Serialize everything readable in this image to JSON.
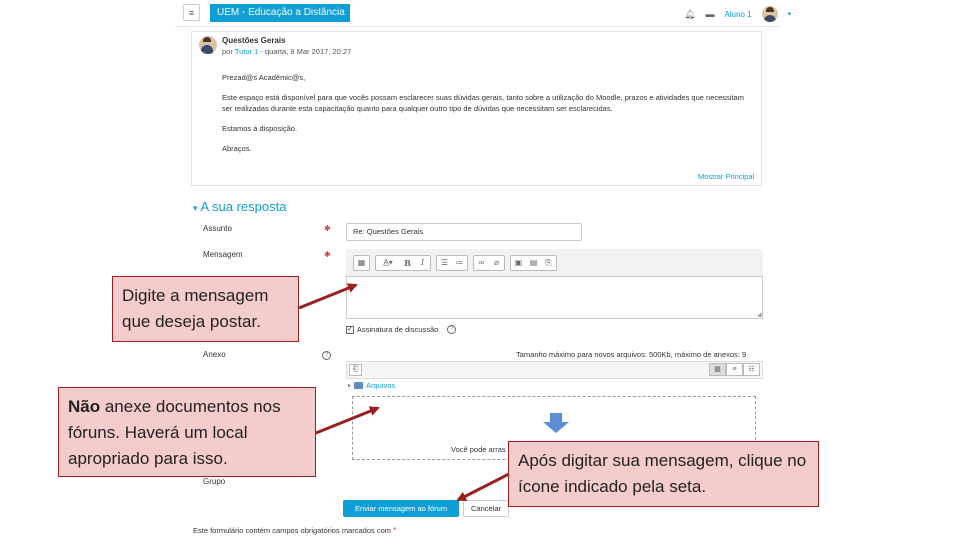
{
  "navbar": {
    "menu_icon": "hamburger-icon",
    "brand": "UEM - Educação a Distância",
    "user_name": "Aluno 1"
  },
  "post": {
    "title": "Questões Gerais",
    "meta_prefix": "por ",
    "author": "Tutor 1",
    "meta_suffix": " - quarta, 8 Mar 2017, 20:27",
    "paragraphs": [
      "Prezad@s Acadêmic@s,",
      "Este espaço está disponível para que vocês possam esclarecer suas dúvidas gerais, tanto sobre a utilização do Moodle, prazos e atividades que necessitam ser realizadas durante esta capacitação quanto para qualquer outro tipo de dúvidas que necessitam ser esclarecidas.",
      "Estamos à disposição.",
      "Abraços."
    ],
    "show_parent": "Mostrar Principal"
  },
  "reply": {
    "section_title": "A sua resposta",
    "subject_label": "Assunto",
    "subject_value": "Re: Questões Gerais",
    "message_label": "Mensagem",
    "signature_label": "Assinatura de discussão",
    "attachment_label": "Anexo",
    "max_size": "Tamanho máximo para novos arquivos: 500Kb, máximo de anexos: 9",
    "files_folder": "Arquivos",
    "drop_text": "Você pode arras",
    "group_label": "Grupo",
    "submit": "Enviar mensagem ao fórum",
    "cancel": "Cancelar",
    "footnote": "Este formulário contém campos obrigatórios marcados com ",
    "required_mark": "*"
  },
  "callouts": {
    "c1": "Digite a mensagem que deseja postar.",
    "c2_bold": "Não",
    "c2_rest": " anexe documentos nos fóruns. Haverá um local apropriado para isso.",
    "c3": "Após digitar sua mensagem, clique no ícone indicado pela seta."
  },
  "colors": {
    "accent": "#0f9ed6",
    "callout_fill": "#f4cccc",
    "callout_border": "#9a1f1f",
    "arrow": "#9a1f1f"
  }
}
